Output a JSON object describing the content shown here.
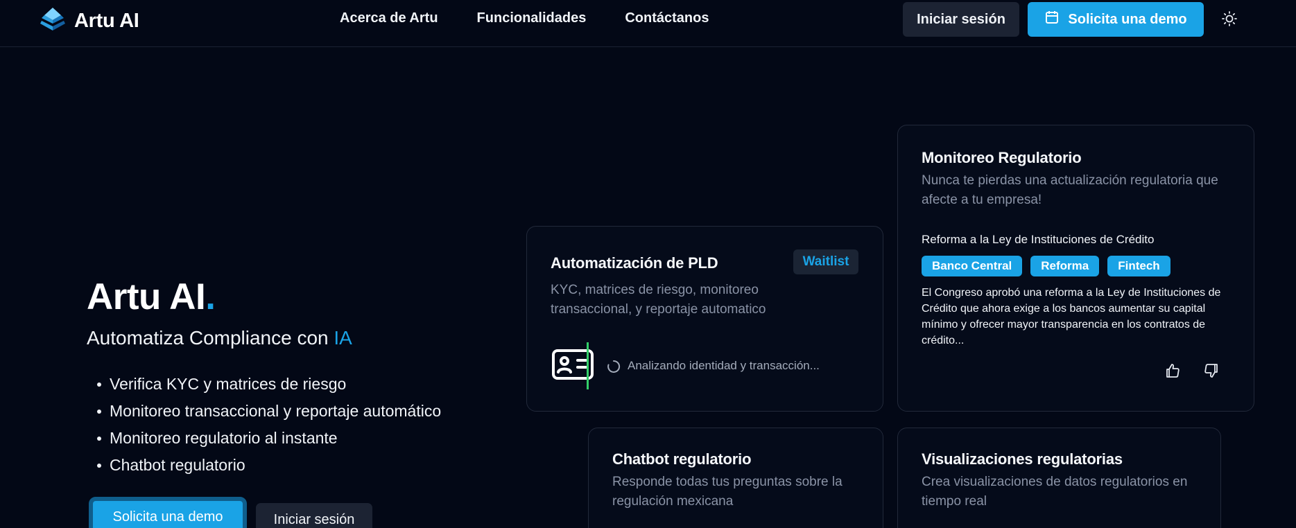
{
  "nav": {
    "brand": "Artu AI",
    "links": [
      "Acerca de Artu",
      "Funcionalidades",
      "Contáctanos"
    ],
    "login_label": "Iniciar sesión",
    "demo_label": "Solicita una demo"
  },
  "hero": {
    "title": "Artu AI",
    "title_dot": ".",
    "subtitle_prefix": "Automatiza Compliance con ",
    "subtitle_accent": "IA",
    "bullets": [
      "Verifica KYC y matrices de riesgo",
      "Monitoreo transaccional y reportaje automático",
      "Monitoreo regulatorio al instante",
      "Chatbot regulatorio"
    ],
    "demo_label": "Solicita una demo",
    "login_label": "Iniciar sesión"
  },
  "cards": {
    "pld": {
      "title": "Automatización de PLD",
      "badge": "Waitlist",
      "desc": "KYC, matrices de riesgo, monitoreo transaccional, y reportaje automatico",
      "status": "Analizando identidad y transacción..."
    },
    "monitoreo": {
      "title": "Monitoreo Regulatorio",
      "desc": "Nunca te pierdas una actualización regulatoria que afecte a tu empresa!",
      "headline": "Reforma a la Ley de Instituciones de Crédito",
      "tags": [
        "Banco Central",
        "Reforma",
        "Fintech"
      ],
      "body": "El Congreso aprobó una reforma a la Ley de Instituciones de Crédito que ahora exige a los bancos aumentar su capital mínimo y ofrecer mayor transparencia en los contratos de crédito..."
    },
    "chatbot": {
      "title": "Chatbot regulatorio",
      "desc": "Responde todas tus preguntas sobre la regulación mexicana"
    },
    "visualizaciones": {
      "title": "Visualizaciones regulatorias",
      "desc": "Crea visualizaciones de datos regulatorios en tiempo real"
    }
  },
  "colors": {
    "background": "#030816",
    "accent": "#1aa3e6",
    "scan": "#33d06a"
  },
  "icons": {
    "logo": "layered-pyramid-logo",
    "calendar": "calendar-icon",
    "theme": "sun-icon",
    "id_card": "id-card-icon",
    "spinner": "spinner-icon",
    "like": "thumbs-up-icon",
    "dislike": "thumbs-down-icon"
  }
}
